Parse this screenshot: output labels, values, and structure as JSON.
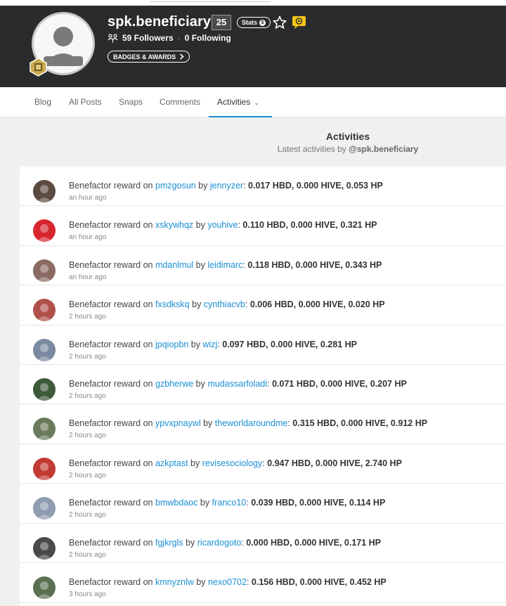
{
  "profile": {
    "username": "spk.beneficiary",
    "reputation": "25",
    "stats_label": "Stats",
    "followers": "59 Followers",
    "following": "0 Following",
    "badges_label": "BADGES & AWARDS"
  },
  "tabs": [
    {
      "label": "Blog"
    },
    {
      "label": "All Posts"
    },
    {
      "label": "Snaps"
    },
    {
      "label": "Comments"
    },
    {
      "label": "Activities"
    }
  ],
  "section": {
    "title": "Activities",
    "subtitle_prefix": "Latest activities by ",
    "subtitle_user": "@spk.beneficiary"
  },
  "activities": [
    {
      "prefix": "Benefactor reward on ",
      "permlink": "pmzgosun",
      "by": " by ",
      "author": "jennyzer",
      "amounts": "0.017 HBD, 0.000 HIVE, 0.053 HP",
      "time": "an hour ago",
      "avatar_color": "#5b4a3f"
    },
    {
      "prefix": "Benefactor reward on ",
      "permlink": "xskywhqz",
      "by": " by ",
      "author": "youhive",
      "amounts": "0.110 HBD, 0.000 HIVE, 0.321 HP",
      "time": "an hour ago",
      "avatar_color": "#d8262e"
    },
    {
      "prefix": "Benefactor reward on ",
      "permlink": "mdanlmul",
      "by": " by ",
      "author": "leidimarc",
      "amounts": "0.118 HBD, 0.000 HIVE, 0.343 HP",
      "time": "an hour ago",
      "avatar_color": "#8a6a62"
    },
    {
      "prefix": "Benefactor reward on ",
      "permlink": "fxsdkskq",
      "by": " by ",
      "author": "cynthiacvb",
      "amounts": "0.006 HBD, 0.000 HIVE, 0.020 HP",
      "time": "2 hours ago",
      "avatar_color": "#b0504a"
    },
    {
      "prefix": "Benefactor reward on ",
      "permlink": "jpqiopbn",
      "by": " by ",
      "author": "wizj",
      "amounts": "0.097 HBD, 0.000 HIVE, 0.281 HP",
      "time": "2 hours ago",
      "avatar_color": "#7a8aa0"
    },
    {
      "prefix": "Benefactor reward on ",
      "permlink": "gzbherwe",
      "by": " by ",
      "author": "mudassarfoladi",
      "amounts": "0.071 HBD, 0.000 HIVE, 0.207 HP",
      "time": "2 hours ago",
      "avatar_color": "#3c5a3a"
    },
    {
      "prefix": "Benefactor reward on ",
      "permlink": "ypvxpnaywl",
      "by": " by ",
      "author": "theworldaroundme",
      "amounts": "0.315 HBD, 0.000 HIVE, 0.912 HP",
      "time": "2 hours ago",
      "avatar_color": "#6a7a5a"
    },
    {
      "prefix": "Benefactor reward on ",
      "permlink": "azkptast",
      "by": " by ",
      "author": "revisesociology",
      "amounts": "0.947 HBD, 0.000 HIVE, 2.740 HP",
      "time": "2 hours ago",
      "avatar_color": "#c23a34"
    },
    {
      "prefix": "Benefactor reward on ",
      "permlink": "bmwbdaoc",
      "by": " by ",
      "author": "franco10",
      "amounts": "0.039 HBD, 0.000 HIVE, 0.114 HP",
      "time": "2 hours ago",
      "avatar_color": "#8e9bb0"
    },
    {
      "prefix": "Benefactor reward on ",
      "permlink": "fgjkrgls",
      "by": " by ",
      "author": "ricardogoto",
      "amounts": "0.000 HBD, 0.000 HIVE, 0.171 HP",
      "time": "2 hours ago",
      "avatar_color": "#4a4a4a"
    },
    {
      "prefix": "Benefactor reward on ",
      "permlink": "kmnyznlw",
      "by": " by ",
      "author": "nexo0702",
      "amounts": "0.156 HBD, 0.000 HIVE, 0.452 HP",
      "time": "3 hours ago",
      "avatar_color": "#5a7050"
    }
  ]
}
